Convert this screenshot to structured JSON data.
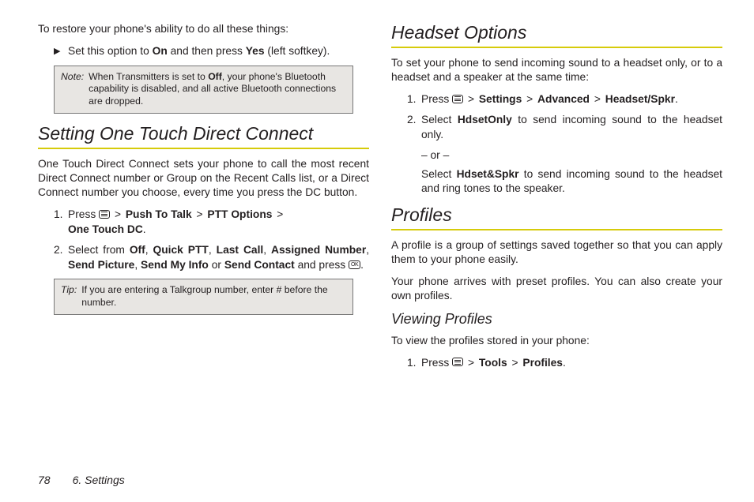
{
  "left": {
    "intro": "To restore your phone's ability to do all these things:",
    "bullet_pre": "Set this option to ",
    "bullet_on": "On",
    "bullet_mid": " and then press ",
    "bullet_yes": "Yes",
    "bullet_post": " (left softkey).",
    "note_label": "Note:",
    "note_body": "When Transmitters is set to Off, your phone's Bluetooth capability is disabled, and all active Bluetooth connections are dropped.",
    "h_connect": "Setting One Touch Direct Connect",
    "connect_para": "One Touch Direct Connect sets your phone to call the most recent Direct Connect number or Group on the Recent Calls list, or a Direct Connect number you choose, every time you press the DC button.",
    "step1_pre": "Press ",
    "step1_a": "Push To Talk",
    "step1_b": "PTT Options",
    "step1_c": "One Touch DC",
    "step2_pre": "Select from ",
    "step2_off": "Off",
    "step2_qptt": "Quick PTT",
    "step2_last": "Last Call",
    "step2_assign": "Assigned Number",
    "step2_pic": "Send Picture",
    "step2_info": "Send My Info",
    "step2_or": " or ",
    "step2_contact": "Send Contact",
    "step2_post": " and press ",
    "tip_label": "Tip:",
    "tip_body": "If you are entering a Talkgroup number, enter # before the number."
  },
  "right": {
    "h_headset": "Headset Options",
    "headset_para": "To set your phone to send incoming sound to a headset only, or to a headset and a speaker at the same time:",
    "hs1_pre": "Press ",
    "hs1_a": "Settings",
    "hs1_b": "Advanced",
    "hs1_c": "Headset/Spkr",
    "hs2_pre": "Select ",
    "hs2_only": "HdsetOnly",
    "hs2_post": " to send incoming sound to the headset only.",
    "or": "– or –",
    "hs2b_pre": "Select ",
    "hs2b_spkr": "Hdset&Spkr",
    "hs2b_post": " to send incoming sound to the headset and ring tones to the speaker.",
    "h_profiles": "Profiles",
    "prof_p1": "A profile is a group of settings saved together so that you can apply them to your phone easily.",
    "prof_p2": "Your phone arrives with preset profiles. You can also create your own profiles.",
    "h_view": "Viewing Profiles",
    "view_para": "To view the profiles stored in your phone:",
    "vp_pre": "Press ",
    "vp_a": "Tools",
    "vp_b": "Profiles"
  },
  "footer": {
    "page": "78",
    "chapter": "6. Settings"
  },
  "glyphs": {
    "gt": ">",
    "ok": "OK"
  }
}
